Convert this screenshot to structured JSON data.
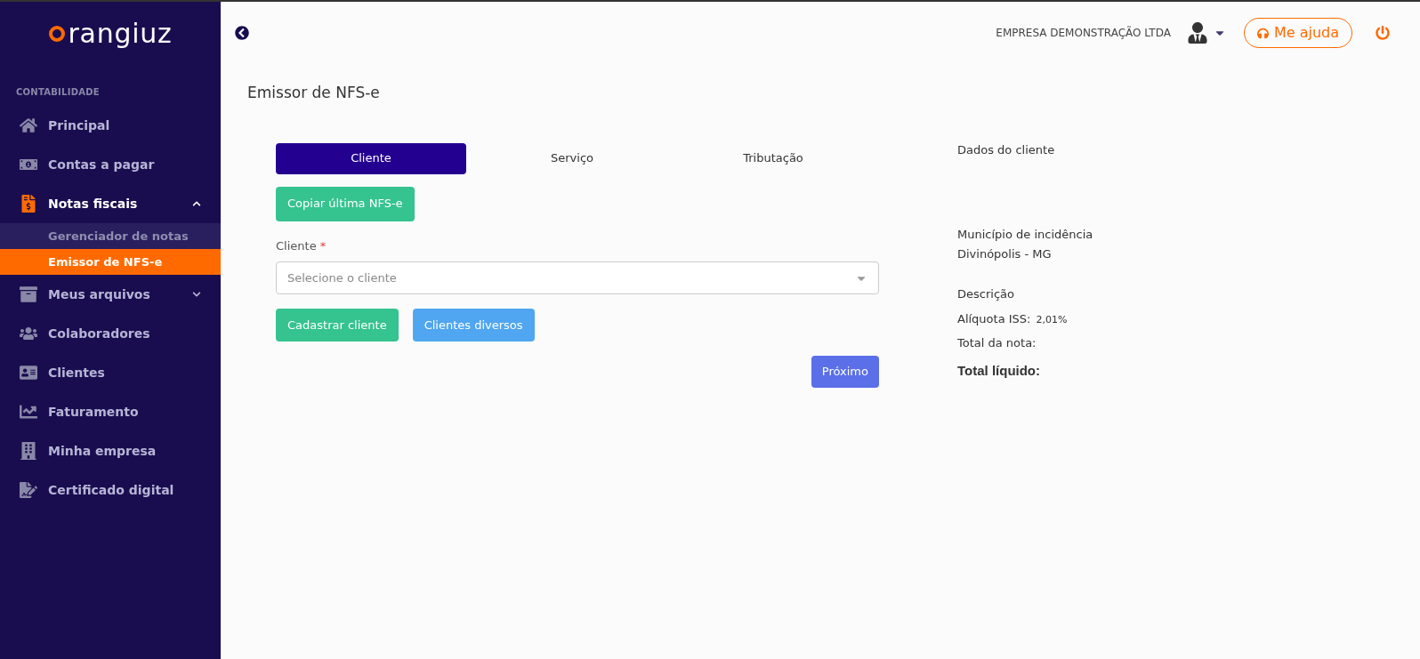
{
  "logo": {
    "wordmark": "rangiuz"
  },
  "sidebar": {
    "section": "CONTABILIDADE",
    "items": [
      {
        "label": "Principal",
        "selected": false
      },
      {
        "label": "Contas a pagar",
        "selected": false
      },
      {
        "label": "Notas fiscais",
        "expanded": true,
        "selected": true,
        "children": [
          {
            "label": "Gerenciador de notas",
            "selected": false
          },
          {
            "label": "Emissor de NFS-e",
            "selected": true
          }
        ]
      },
      {
        "label": "Meus arquivos",
        "expanded": false,
        "selected": false
      },
      {
        "label": "Colaboradores",
        "selected": false
      },
      {
        "label": "Clientes",
        "selected": false
      },
      {
        "label": "Faturamento",
        "selected": false
      },
      {
        "label": "Minha empresa",
        "selected": false
      },
      {
        "label": "Certificado digital",
        "selected": false
      }
    ]
  },
  "header": {
    "company": "EMPRESA DEMONSTRAÇÃO LTDA",
    "help_button": "Me ajuda"
  },
  "page_title": "Emissor de NFS-e",
  "tabs": [
    {
      "label": "Cliente",
      "selected": true
    },
    {
      "label": "Serviço",
      "selected": false
    },
    {
      "label": "Tributação",
      "selected": false
    }
  ],
  "copy_button": "Copiar última NFS-e",
  "client_field": {
    "label": "Cliente",
    "required_mark": "*",
    "placeholder": "Selecione o cliente"
  },
  "client_buttons": [
    {
      "label": "Cadastrar cliente",
      "kind": "green"
    },
    {
      "label": "Clientes diversos",
      "kind": "blue"
    }
  ],
  "next_button": "Próximo",
  "summary": {
    "client_heading": "Dados do cliente",
    "municipality_label": "Município de incidência",
    "municipality": "Divinópolis - MG",
    "description_label": "Descrição",
    "iss_label": "Alíquota ISS:",
    "iss_value": "2,01%",
    "total_label": "Total da nota:",
    "net_label": "Total líquido:"
  }
}
